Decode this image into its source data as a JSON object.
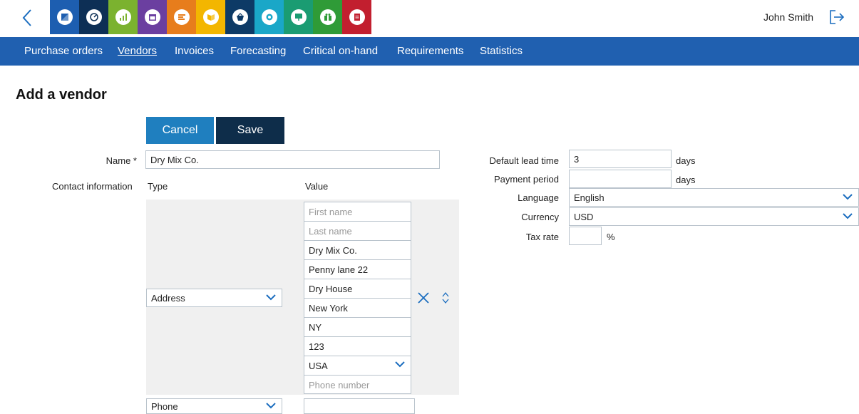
{
  "header": {
    "user_name": "John Smith",
    "apps": [
      {
        "name": "app-1",
        "color": "#1d5eb0",
        "icon": "compass-icon"
      },
      {
        "name": "app-2",
        "color": "#0d2f55",
        "icon": "dashboard-icon"
      },
      {
        "name": "app-3",
        "color": "#7bb22f",
        "icon": "bar-chart-icon"
      },
      {
        "name": "app-4",
        "color": "#6b3fa0",
        "icon": "calendar-icon"
      },
      {
        "name": "app-5",
        "color": "#e77d1c",
        "icon": "list-icon"
      },
      {
        "name": "app-6",
        "color": "#f3b600",
        "icon": "book-icon"
      },
      {
        "name": "app-7",
        "color": "#0d3a66",
        "icon": "basket-icon"
      },
      {
        "name": "app-8",
        "color": "#1aa7c8",
        "icon": "gear-icon"
      },
      {
        "name": "app-9",
        "color": "#1a9c72",
        "icon": "presentation-icon"
      },
      {
        "name": "app-10",
        "color": "#2f9b37",
        "icon": "gift-icon"
      },
      {
        "name": "app-11",
        "color": "#c21f2f",
        "icon": "document-icon"
      }
    ]
  },
  "nav": {
    "items": [
      {
        "label": "Purchase orders"
      },
      {
        "label": "Vendors"
      },
      {
        "label": "Invoices"
      },
      {
        "label": "Forecasting"
      },
      {
        "label": "Critical on-hand"
      },
      {
        "label": "Requirements"
      },
      {
        "label": "Statistics"
      }
    ]
  },
  "page": {
    "title": "Add a vendor",
    "cancel_label": "Cancel",
    "save_label": "Save"
  },
  "form": {
    "name_label": "Name *",
    "name_value": "Dry Mix Co.",
    "contact_label": "Contact information",
    "type_header": "Type",
    "value_header": "Value",
    "address_type": "Address",
    "address_fields": [
      {
        "value": "",
        "placeholder": "First name"
      },
      {
        "value": "",
        "placeholder": "Last name"
      },
      {
        "value": "Dry Mix Co.",
        "placeholder": ""
      },
      {
        "value": "Penny lane 22",
        "placeholder": ""
      },
      {
        "value": "Dry House",
        "placeholder": ""
      },
      {
        "value": "New York",
        "placeholder": ""
      },
      {
        "value": "NY",
        "placeholder": ""
      },
      {
        "value": "123",
        "placeholder": ""
      },
      {
        "value": "USA",
        "placeholder": "",
        "dropdown": true
      },
      {
        "value": "",
        "placeholder": "Phone number"
      }
    ],
    "phone_type": "Phone",
    "phone_value": ""
  },
  "settings": {
    "lead_time_label": "Default lead time",
    "lead_time_value": "3",
    "lead_time_unit": "days",
    "payment_label": "Payment period",
    "payment_value": "",
    "payment_unit": "days",
    "language_label": "Language",
    "language_value": "English",
    "currency_label": "Currency",
    "currency_value": "USD",
    "tax_label": "Tax rate",
    "tax_value": "",
    "tax_unit": "%"
  },
  "colors": {
    "nav_bg": "#2060b0",
    "cancel_bg": "#1f7fbf",
    "save_bg": "#0e2d4a",
    "accent": "#1b6dbf"
  }
}
